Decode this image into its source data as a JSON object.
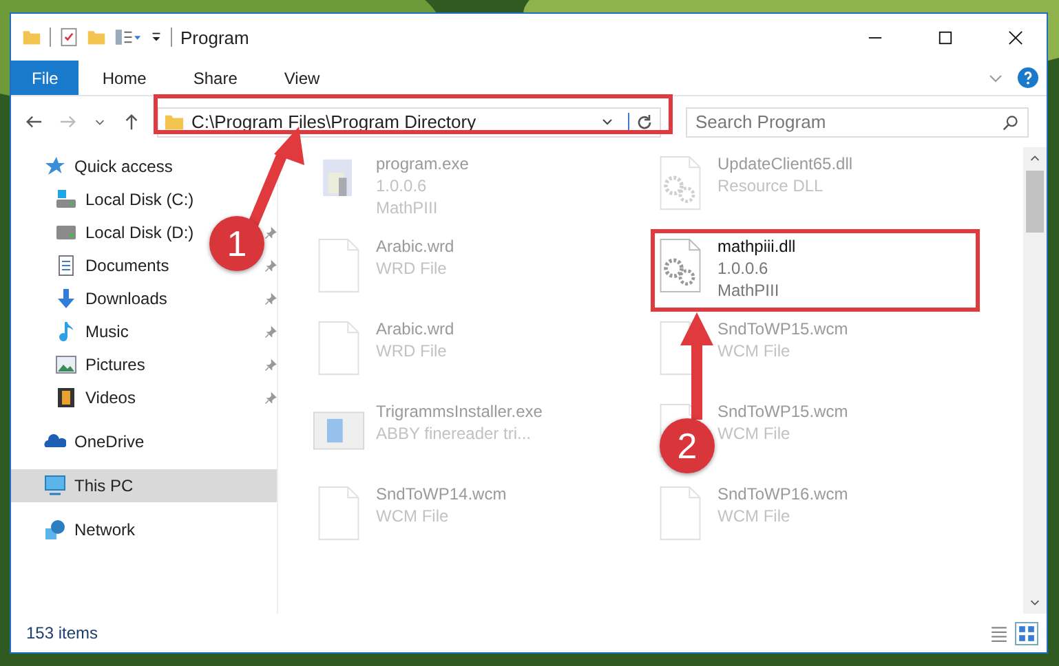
{
  "window": {
    "title": "Program"
  },
  "ribbon_tabs": [
    {
      "label": "File",
      "kind": "file"
    },
    {
      "label": "Home",
      "kind": "tab"
    },
    {
      "label": "Share",
      "kind": "tab"
    },
    {
      "label": "View",
      "kind": "tab"
    }
  ],
  "address": {
    "path": "C:\\Program Files\\Program Directory"
  },
  "search": {
    "placeholder": "Search Program"
  },
  "nav": [
    {
      "label": "Quick access",
      "selected": false,
      "children": [
        {
          "label": "Local Disk (C:)",
          "selected": false
        },
        {
          "label": "Local Disk (D:)",
          "pinned": true,
          "selected": false
        },
        {
          "label": "Documents",
          "pinned": true,
          "selected": false
        },
        {
          "label": "Downloads",
          "pinned": true,
          "selected": false
        },
        {
          "label": "Music",
          "pinned": true,
          "selected": false
        },
        {
          "label": "Pictures",
          "pinned": true,
          "selected": false
        },
        {
          "label": "Videos",
          "pinned": true,
          "selected": false
        }
      ]
    },
    {
      "label": "OneDrive",
      "selected": false
    },
    {
      "label": "This PC",
      "selected": true
    },
    {
      "label": "Network",
      "selected": false
    }
  ],
  "files": [
    {
      "name": "program.exe",
      "details": [
        "1.0.0.6",
        "MathPIII"
      ],
      "blurred": true
    },
    {
      "name": "UpdateClient65.dll",
      "details": [
        "Resource DLL"
      ],
      "blurred": true
    },
    {
      "name": "Arabic.wrd",
      "details": [
        "WRD File"
      ],
      "blurred": true
    },
    {
      "name": "mathpiii.dll",
      "details": [
        "1.0.0.6",
        "MathPIII"
      ],
      "blurred": false
    },
    {
      "name": "Arabic.wrd",
      "details": [
        "WRD File"
      ],
      "blurred": true
    },
    {
      "name": "SndToWP15.wcm",
      "details": [
        "WCM File"
      ],
      "blurred": true
    },
    {
      "name": "TrigrammsInstaller.exe",
      "details": [
        "ABBY finereader tri..."
      ],
      "blurred": true
    },
    {
      "name": "SndToWP15.wcm",
      "details": [
        "WCM File"
      ],
      "blurred": true
    },
    {
      "name": "SndToWP14.wcm",
      "details": [
        "WCM File"
      ],
      "blurred": true
    },
    {
      "name": "SndToWP16.wcm",
      "details": [
        "WCM File"
      ],
      "blurred": true
    }
  ],
  "status_bar": {
    "item_count": "153 items"
  },
  "annotations": [
    {
      "label": "1"
    },
    {
      "label": "2"
    }
  ]
}
